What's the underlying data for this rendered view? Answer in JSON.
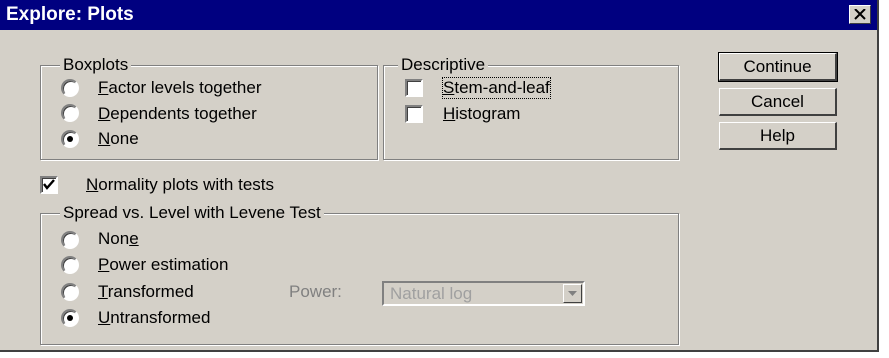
{
  "window": {
    "title": "Explore: Plots",
    "close_icon": "close-icon"
  },
  "boxplots": {
    "legend": "Boxplots",
    "options": [
      {
        "label_hot": "F",
        "label_rest": "actor levels together",
        "selected": false
      },
      {
        "label_hot": "D",
        "label_rest": "ependents together",
        "selected": false
      },
      {
        "label_hot": "N",
        "label_rest": "one",
        "selected": true
      }
    ]
  },
  "descriptive": {
    "legend": "Descriptive",
    "stem_hot": "S",
    "stem_rest": "tem-and-leaf",
    "stem_checked": false,
    "hist_hot": "H",
    "hist_rest": "istogram",
    "hist_checked": false
  },
  "normality": {
    "hot": "N",
    "rest": "ormality plots with tests",
    "checked": true
  },
  "spread": {
    "legend": "Spread vs. Level with Levene Test",
    "none_pre": "Non",
    "none_hot": "e",
    "power_hot": "P",
    "power_rest": "ower estimation",
    "transformed_hot": "T",
    "transformed_rest": "ransformed",
    "untransformed_hot": "U",
    "untransformed_rest": "ntransformed",
    "selected": "Untransformed",
    "power_label": "Power:",
    "power_value": "Natural log"
  },
  "buttons": {
    "continue": "Continue",
    "cancel": "Cancel",
    "help": "Help"
  },
  "colors": {
    "title_bar": "#000080",
    "face": "#d4d0c8"
  }
}
